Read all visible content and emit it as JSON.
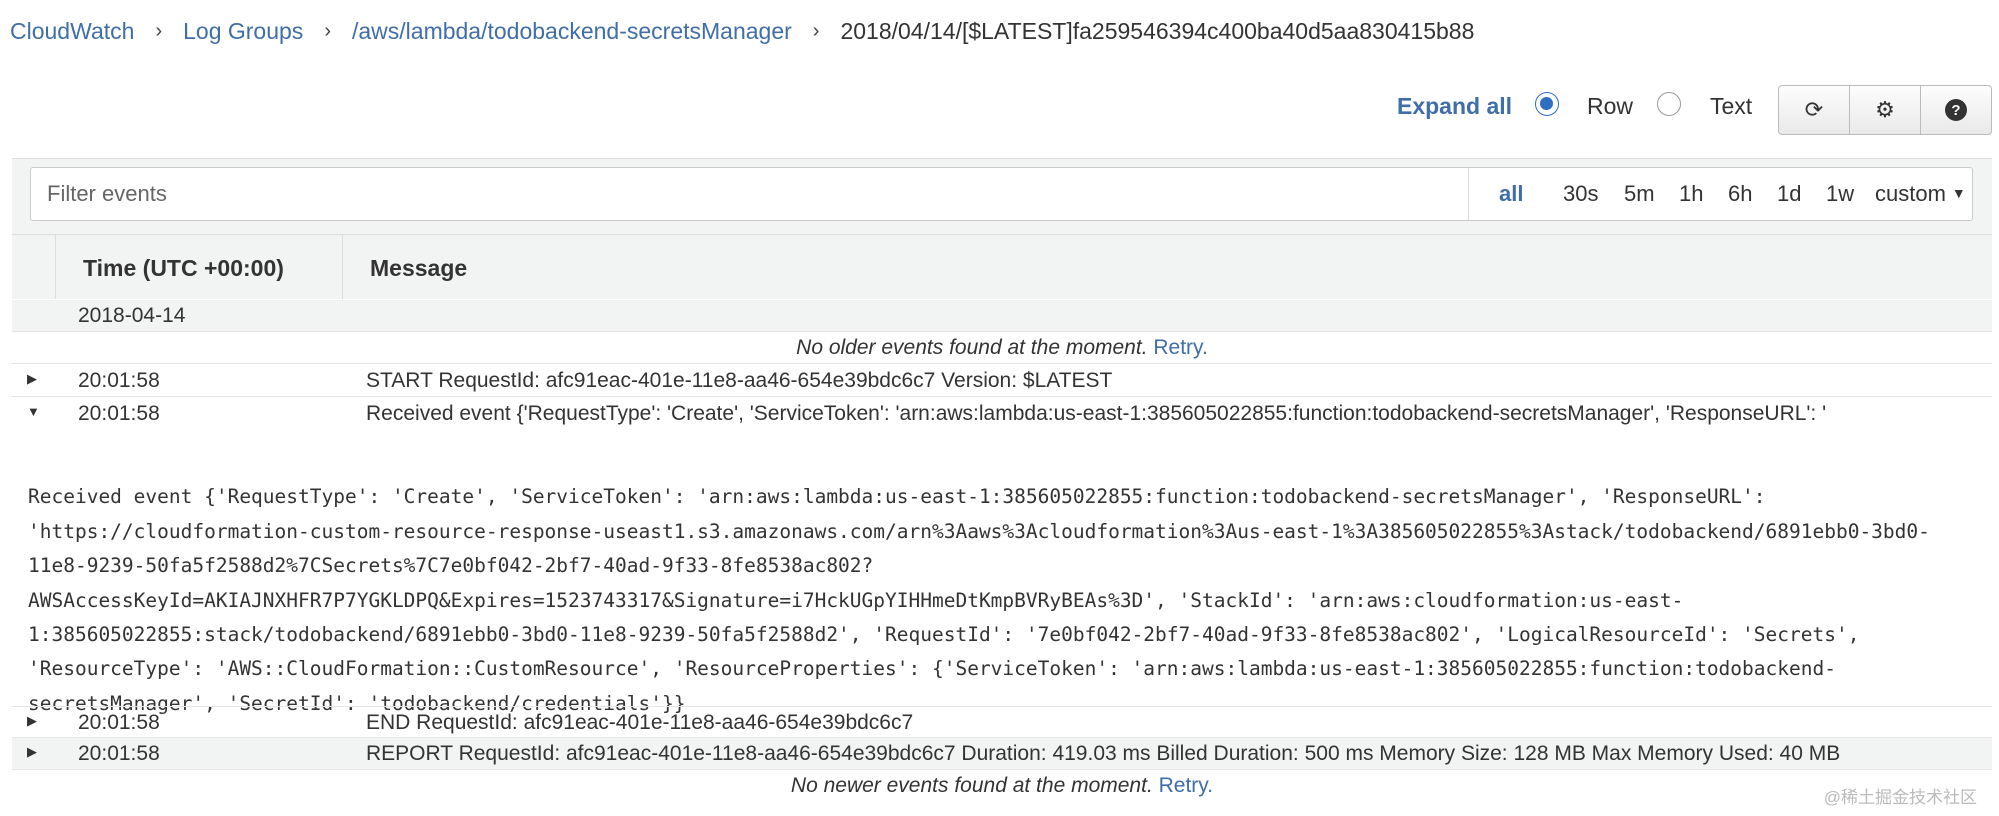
{
  "breadcrumb": {
    "items": [
      "CloudWatch",
      "Log Groups",
      "/aws/lambda/todobackend-secretsManager"
    ],
    "current": "2018/04/14/[$LATEST]fa259546394c400ba40d5aa830415b88",
    "separator": "›"
  },
  "toolbar": {
    "expand_all": "Expand all",
    "view_modes": [
      "Row",
      "Text"
    ],
    "selected_view": "Row",
    "buttons": [
      {
        "icon": "refresh-icon",
        "glyph": "⟳"
      },
      {
        "icon": "gear-icon",
        "glyph": "⚙"
      },
      {
        "icon": "help-icon",
        "glyph": "?"
      }
    ]
  },
  "filter": {
    "placeholder": "Filter events",
    "value": "",
    "ranges": [
      "all",
      "30s",
      "5m",
      "1h",
      "6h",
      "1d",
      "1w",
      "custom"
    ],
    "selected_range": "all"
  },
  "table": {
    "columns": [
      "Time (UTC +00:00)",
      "Message"
    ],
    "date_row": "2018-04-14",
    "older_notice": "No older events found at the moment.",
    "newer_notice": "No newer events found at the moment.",
    "retry_label": "Retry.",
    "rows": [
      {
        "time": "20:01:58",
        "message": "START RequestId: afc91eac-401e-11e8-aa46-654e39bdc6c7 Version: $LATEST",
        "expanded": false
      },
      {
        "time": "20:01:58",
        "message": "Received event {'RequestType': 'Create', 'ServiceToken': 'arn:aws:lambda:us-east-1:385605022855:function:todobackend-secretsManager', 'ResponseURL': '",
        "expanded": true
      },
      {
        "time": "20:01:58",
        "message": "END RequestId: afc91eac-401e-11e8-aa46-654e39bdc6c7",
        "expanded": false
      },
      {
        "time": "20:01:58",
        "message": "REPORT RequestId: afc91eac-401e-11e8-aa46-654e39bdc6c7 Duration: 419.03 ms Billed Duration: 500 ms Memory Size: 128 MB Max Memory Used: 40 MB",
        "expanded": false
      }
    ],
    "expanded_detail_lines": [
      "Received event {'RequestType': 'Create', 'ServiceToken': 'arn:aws:lambda:us-east-1:385605022855:function:todobackend-secretsManager', 'ResponseURL':",
      "'https://cloudformation-custom-resource-response-useast1.s3.amazonaws.com/arn%3Aaws%3Acloudformation%3Aus-east-1%3A385605022855%3Astack/todobackend/6891ebb0-3bd0-",
      "11e8-9239-50fa5f2588d2%7CSecrets%7C7e0bf042-2bf7-40ad-9f33-8fe8538ac802?",
      "AWSAccessKeyId=AKIAJNXHFR7P7YGKLDPQ&Expires=1523743317&Signature=i7HckUGpYIHHmeDtKmpBVRyBEAs%3D', 'StackId': 'arn:aws:cloudformation:us-east-",
      "1:385605022855:stack/todobackend/6891ebb0-3bd0-11e8-9239-50fa5f2588d2', 'RequestId': '7e0bf042-2bf7-40ad-9f33-8fe8538ac802', 'LogicalResourceId': 'Secrets',",
      "'ResourceType': 'AWS::CloudFormation::CustomResource', 'ResourceProperties': {'ServiceToken': 'arn:aws:lambda:us-east-1:385605022855:function:todobackend-",
      "secretsManager', 'SecretId': 'todobackend/credentials'}}"
    ]
  },
  "watermark": "@稀土掘金技术社区",
  "colors": {
    "link": "#3f6ea8",
    "radio": "#2f6fbf",
    "panel_bg": "#f2f3f3"
  }
}
